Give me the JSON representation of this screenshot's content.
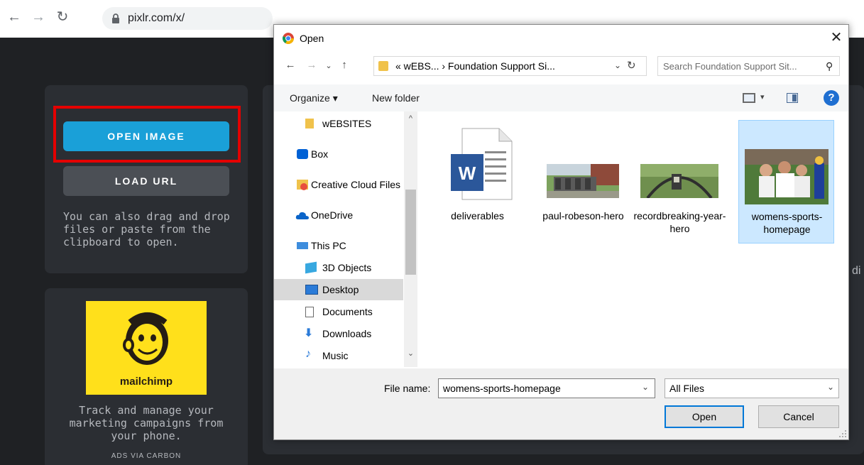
{
  "browser": {
    "url": "pixlr.com/x/"
  },
  "pixlr": {
    "open_image_label": "OPEN IMAGE",
    "load_url_label": "LOAD URL",
    "drag_text": "You can also drag and drop files or paste from the clipboard to open.",
    "ad": {
      "logo_text": "mailchimp",
      "text": "Track and manage your marketing campaigns from your phone.",
      "via": "ADS VIA CARBON"
    },
    "partial_text": "di"
  },
  "dialog": {
    "title": "Open",
    "breadcrumb": "« wEBS... › Foundation Support Si...",
    "search_placeholder": "Search Foundation Support Sit...",
    "toolbar": {
      "organize": "Organize ▾",
      "new_folder": "New folder"
    },
    "nav_items": [
      {
        "label": "wEBSITES",
        "icon": "folder-icon"
      },
      {
        "label": "Box",
        "icon": "box-icon"
      },
      {
        "label": "Creative Cloud Files",
        "icon": "creative-cloud-icon"
      },
      {
        "label": "OneDrive",
        "icon": "onedrive-icon"
      },
      {
        "label": "This PC",
        "icon": "computer-icon"
      },
      {
        "label": "3D Objects",
        "icon": "cube-icon"
      },
      {
        "label": "Desktop",
        "icon": "desktop-icon"
      },
      {
        "label": "Documents",
        "icon": "document-icon"
      },
      {
        "label": "Downloads",
        "icon": "download-icon"
      },
      {
        "label": "Music",
        "icon": "music-icon"
      }
    ],
    "files": [
      {
        "name": "deliverables",
        "type": "word-document"
      },
      {
        "name": "paul-robeson-hero",
        "type": "image"
      },
      {
        "name": "recordbreaking-year-hero",
        "type": "image"
      },
      {
        "name": "womens-sports-homepage",
        "type": "image"
      }
    ],
    "file_name_label": "File name:",
    "file_name_value": "womens-sports-homepage",
    "file_type_value": "All Files",
    "open_label": "Open",
    "cancel_label": "Cancel"
  },
  "colors": {
    "accent_blue": "#1aa0d8",
    "highlight_red": "#e40000",
    "selection": "#cce8ff"
  }
}
